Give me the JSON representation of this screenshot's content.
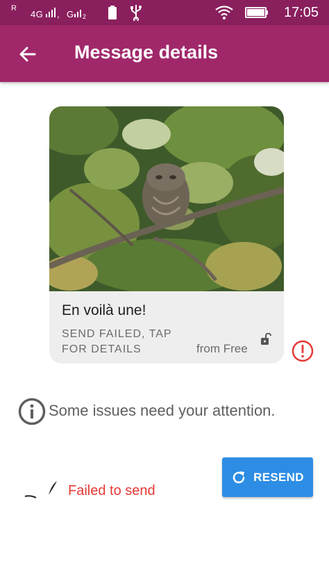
{
  "status_bar": {
    "carrier_indicator": "R",
    "network": "4G      , G     ",
    "time": "17:05"
  },
  "app_bar": {
    "title": "Message details"
  },
  "message": {
    "text": "En voilà une!",
    "status": "SEND FAILED, TAP FOR DETAILS",
    "sender": "from Free"
  },
  "issues": {
    "text": "Some issues need your attention."
  },
  "failure": {
    "text": "Failed to send",
    "resend_label": "RESEND"
  },
  "colors": {
    "status_bar": "#8a1f5e",
    "app_bar": "#a0286a",
    "error": "#e53935",
    "button": "#2d8de4"
  }
}
